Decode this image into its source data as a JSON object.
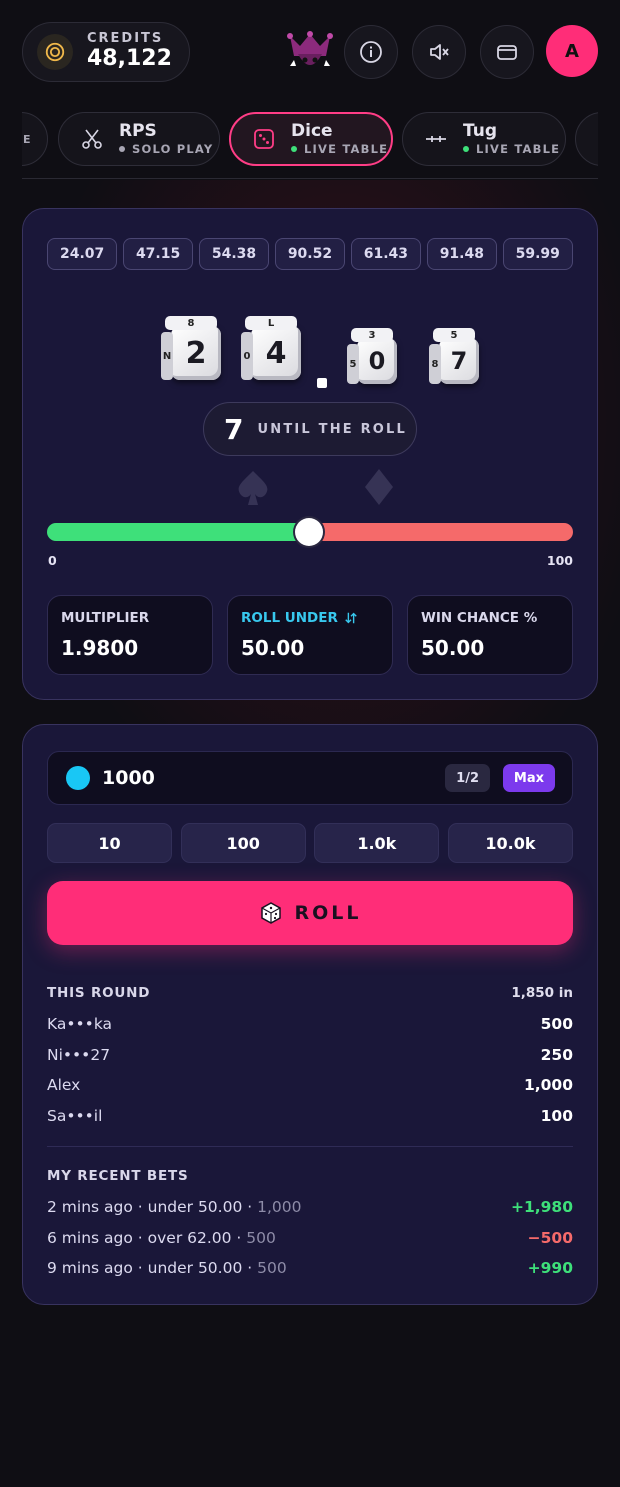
{
  "header": {
    "credits_label": "CREDITS",
    "credits_value": "48,122",
    "avatar_initial": "A"
  },
  "tabs": [
    {
      "name": "RPS",
      "sub": "SOLO PLAY",
      "status_color": "#a8a6b4",
      "icon": "scissors-icon"
    },
    {
      "name": "Dice",
      "sub": "LIVE TABLE",
      "status_color": "#3ee07a",
      "icon": "dice-icon"
    },
    {
      "name": "Tug",
      "sub": "LIVE TABLE",
      "status_color": "#3ee07a",
      "icon": "rope-icon"
    }
  ],
  "history": [
    "24.07",
    "47.15",
    "54.38",
    "90.52",
    "61.43",
    "91.48",
    "59.99"
  ],
  "dice_display": {
    "digits": [
      "2",
      "4",
      "0",
      "7"
    ],
    "until_count": "7",
    "until_label": "UNTIL THE ROLL"
  },
  "slider": {
    "min": "0",
    "max": "100",
    "value": 50
  },
  "stats": {
    "multiplier_label": "MULTIPLIER",
    "multiplier_value": "1.9800",
    "roll_under_label": "ROLL UNDER",
    "roll_under_value": "50.00",
    "win_chance_label": "WIN CHANCE %",
    "win_chance_value": "50.00"
  },
  "bet": {
    "amount": "1000",
    "half_label": "1/2",
    "max_label": "Max",
    "quick_amounts": [
      "10",
      "100",
      "1.0k",
      "10.0k"
    ],
    "roll_label": "ROLL"
  },
  "this_round": {
    "title": "THIS ROUND",
    "summary": "1,850 in",
    "rows": [
      {
        "name": "Ka•••ka",
        "amount": "500"
      },
      {
        "name": "Ni•••27",
        "amount": "250"
      },
      {
        "name": "Alex",
        "amount": "1,000"
      },
      {
        "name": "Sa•••il",
        "amount": "100"
      }
    ]
  },
  "recent_bets": {
    "title": "MY RECENT BETS",
    "rows": [
      {
        "desc": "2 mins ago · under 50.00 · ",
        "stake": "1,000",
        "result": "+1,980",
        "positive": true
      },
      {
        "desc": "6 mins ago · over 62.00 · ",
        "stake": "500",
        "result": "−500",
        "positive": false
      },
      {
        "desc": "9 mins ago · under 50.00 · ",
        "stake": "500",
        "result": "+990",
        "positive": true
      }
    ]
  },
  "colors": {
    "accent": "#ff2d78",
    "win": "#3ee07a",
    "loss": "#f56a6a",
    "card_bg": "#1a1739",
    "max_button": "#7c3aed",
    "coin": "#19c7f5"
  }
}
